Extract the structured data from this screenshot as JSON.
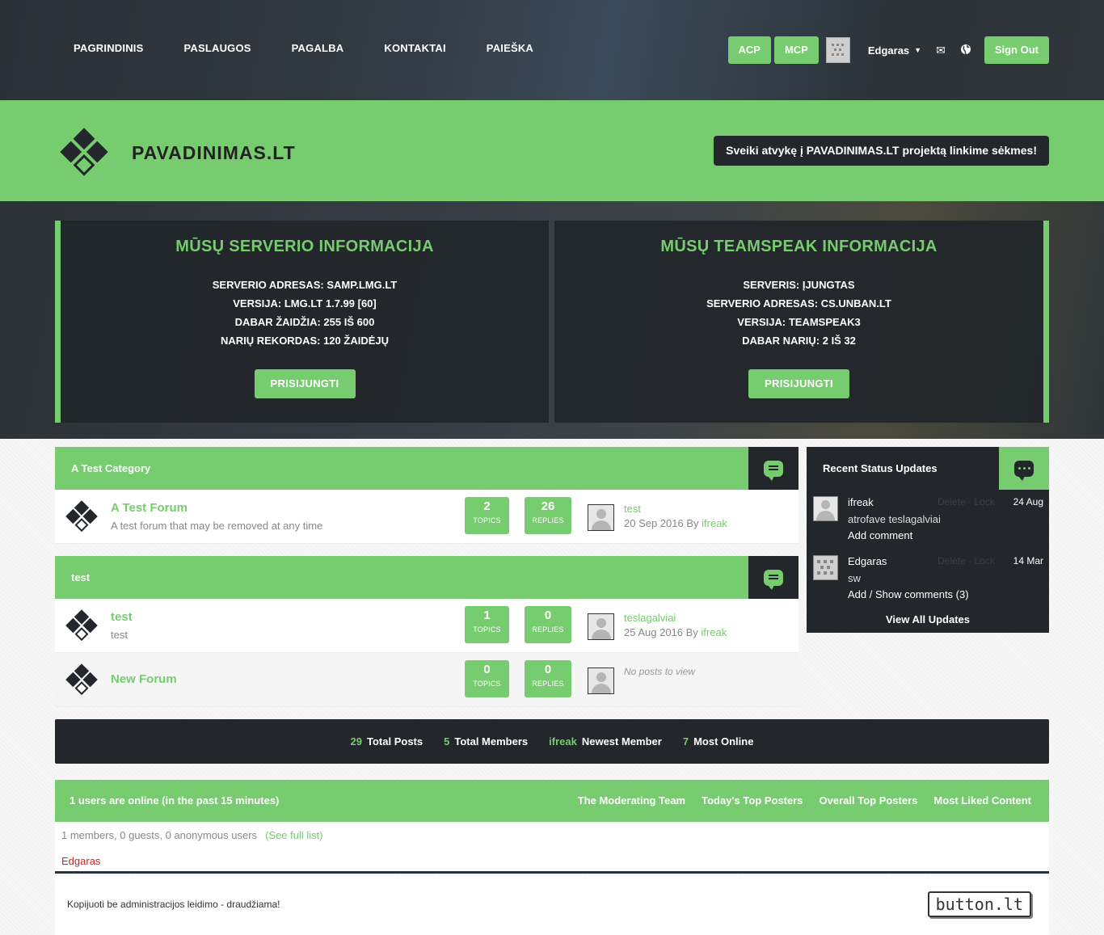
{
  "nav": {
    "items": [
      "PAGRINDINIS",
      "PASLAUGOS",
      "PAGALBA",
      "KONTAKTAI",
      "PAIEŠKA"
    ],
    "acp": "ACP",
    "mcp": "MCP",
    "username": "Edgaras",
    "signout": "Sign Out"
  },
  "header": {
    "sitename": "PAVADINIMAS.LT",
    "welcome": "Sveiki atvykę į PAVADINIMAS.LT projektą linkime sėkmes!"
  },
  "server": {
    "title": "MŪSŲ SERVERIO INFORMACIJA",
    "lines": [
      "SERVERIO ADRESAS: SAMP.LMG.LT",
      "VERSIJA: LMG.LT 1.7.99 [60]",
      "DABAR ŽAIDŽIA: 255 IŠ 600",
      "NARIŲ REKORDAS: 120 ŽAIDĖJŲ"
    ],
    "button": "PRISIJUNGTI"
  },
  "teamspeak": {
    "title": "MŪSŲ TEAMSPEAK INFORMACIJA",
    "lines": [
      "SERVERIS: ĮJUNGTAS",
      "SERVERIO ADRESAS: CS.UNBAN.LT",
      "VERSIJA: TEAMSPEAK3",
      "DABAR NARIŲ: 2 IŠ 32"
    ],
    "button": "PRISIJUNGTI"
  },
  "categories": [
    {
      "title": "A Test Category",
      "forums": [
        {
          "name": "A Test Forum",
          "desc": "A test forum that may be removed at any time",
          "topics": "2",
          "replies": "26",
          "last_title": "test",
          "last_date": "20 Sep 2016 By ",
          "last_user": "ifreak"
        }
      ]
    },
    {
      "title": "test",
      "forums": [
        {
          "name": "test",
          "desc": "test",
          "topics": "1",
          "replies": "0",
          "last_title": "teslagalviai",
          "last_date": "25 Aug 2016 By ",
          "last_user": "ifreak"
        },
        {
          "name": "New Forum",
          "topics": "0",
          "replies": "0",
          "noposts": "No posts to view"
        }
      ]
    }
  ],
  "labels": {
    "topics": "TOPICS",
    "replies": "REPLIES"
  },
  "status": {
    "title": "Recent Status Updates",
    "items": [
      {
        "name": "ifreak",
        "delete": "Delete",
        "sep": "·",
        "lock": "Lock",
        "date": "24 Aug",
        "text": "atrofave teslagalviai",
        "link": "Add comment"
      },
      {
        "name": "Edgaras",
        "delete": "Delete",
        "sep": "·",
        "lock": "Lock",
        "date": "14 Mar",
        "text": "sw",
        "link": "Add / Show comments (3)"
      }
    ],
    "viewall": "View All Updates"
  },
  "stats": [
    {
      "value": "29",
      "label": "Total Posts"
    },
    {
      "value": "5",
      "label": "Total Members"
    },
    {
      "value": "ifreak",
      "label": "Newest Member"
    },
    {
      "value": "7",
      "label": "Most Online"
    }
  ],
  "online": {
    "title": "1 users are online (in the past 15 minutes)",
    "links": [
      "The Moderating Team",
      "Today's Top Posters",
      "Overall Top Posters",
      "Most Liked Content"
    ],
    "count": "1 members, 0 guests, 0 anonymous users",
    "fulllist": "(See full list)",
    "user": "Edgaras"
  },
  "footer": {
    "copy": "Kopijuoti be administracijos leidimo - draudžiama!",
    "badge": "button.lt"
  },
  "colors": {
    "accent": "#76cc6e",
    "dark": "#23272b"
  }
}
